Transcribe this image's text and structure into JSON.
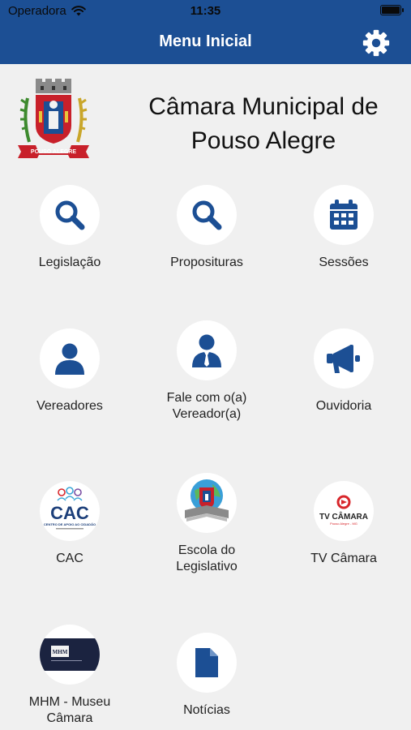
{
  "status_bar": {
    "carrier": "Operadora",
    "time": "11:35",
    "wifi_icon": "wifi-icon",
    "battery_icon": "battery-icon"
  },
  "nav": {
    "title": "Menu Inicial",
    "settings_icon": "gear-icon"
  },
  "header": {
    "name_line1": "Câmara Municipal de",
    "name_line2": "Pouso Alegre",
    "crest_banner": "POUSO ALEGRE"
  },
  "menu": [
    {
      "label": "Legislação",
      "icon": "search-icon"
    },
    {
      "label": "Proposituras",
      "icon": "search-icon"
    },
    {
      "label": "Sessões",
      "icon": "calendar-icon"
    },
    {
      "label": "Vereadores",
      "icon": "user-icon"
    },
    {
      "label_line1": "Fale com o(a)",
      "label_line2": "Vereador(a)",
      "icon": "user-tie-icon"
    },
    {
      "label": "Ouvidoria",
      "icon": "megaphone-icon"
    },
    {
      "label": "CAC",
      "icon": "cac-logo",
      "logo_text": "CAC",
      "logo_sub": "CENTRO DE APOIO AO CIDADÃO"
    },
    {
      "label_line1": "Escola do",
      "label_line2": "Legislativo",
      "icon": "school-logo"
    },
    {
      "label": "TV Câmara",
      "icon": "tv-camara-logo",
      "logo_text": "TV CÂMARA",
      "logo_sub": "Pouso Alegre - MG"
    },
    {
      "label_line1": "MHM - Museu",
      "label_line2": "Câmara",
      "icon": "mhm-logo",
      "logo_text": "MHM"
    },
    {
      "label": "Notícias",
      "icon": "document-icon"
    }
  ],
  "colors": {
    "primary": "#1c4f94",
    "background": "#f0f0f0",
    "icon_blue": "#1c4f94",
    "tv_red": "#d8262b"
  }
}
